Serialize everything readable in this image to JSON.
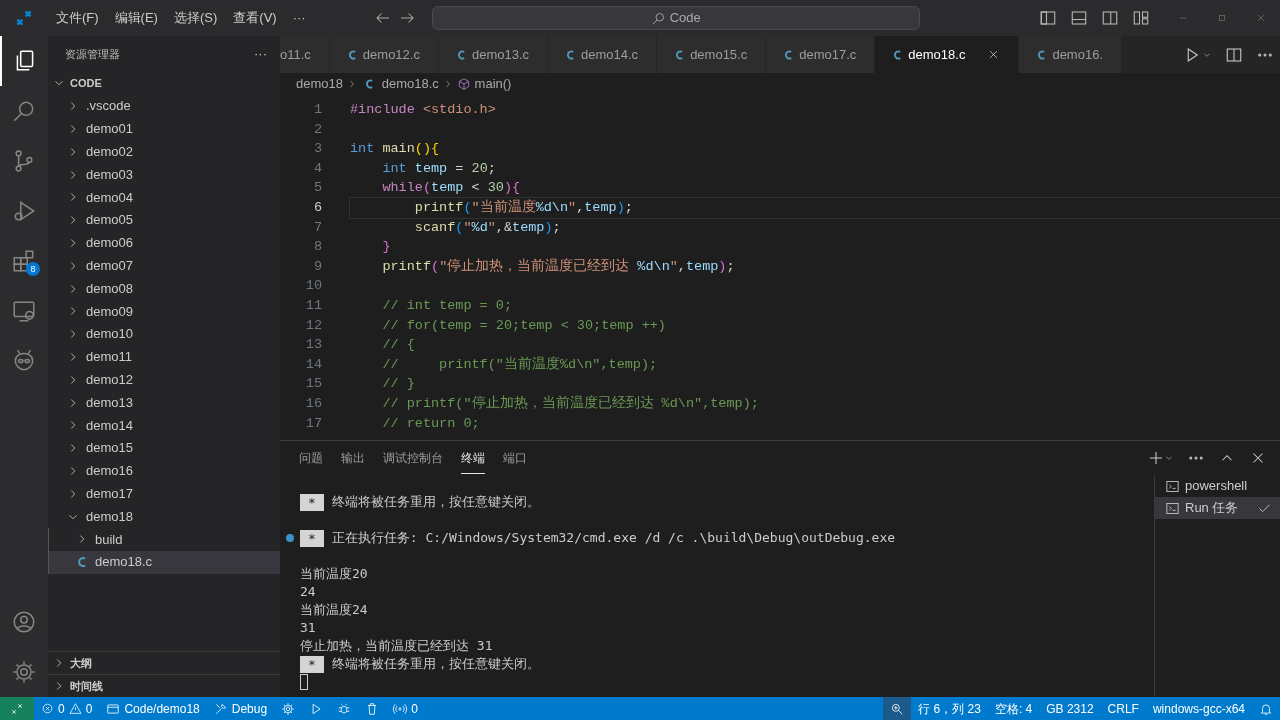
{
  "title_bar": {
    "menus": [
      "文件(F)",
      "编辑(E)",
      "选择(S)",
      "查看(V)",
      "···"
    ],
    "search": {
      "placeholder": "Code"
    }
  },
  "activity_bar": {
    "items": [
      {
        "kind": "files",
        "selected": true
      },
      {
        "kind": "search",
        "selected": false
      },
      {
        "kind": "source-control",
        "selected": false
      },
      {
        "kind": "run-debug",
        "selected": false
      },
      {
        "kind": "extensions",
        "selected": false,
        "badge": "8"
      },
      {
        "kind": "remote",
        "selected": false
      },
      {
        "kind": "alien",
        "selected": false
      }
    ],
    "bottom": [
      {
        "kind": "account"
      },
      {
        "kind": "settings"
      }
    ]
  },
  "sidebar": {
    "title": "资源管理器",
    "more": "···",
    "root": {
      "label": "CODE",
      "expanded": true
    },
    "items": [
      {
        "label": ".vscode",
        "kind": "folder",
        "expanded": false,
        "selected": false
      },
      {
        "label": "demo01",
        "kind": "folder",
        "expanded": false,
        "selected": false
      },
      {
        "label": "demo02",
        "kind": "folder",
        "expanded": false,
        "selected": false
      },
      {
        "label": "demo03",
        "kind": "folder",
        "expanded": false,
        "selected": false
      },
      {
        "label": "demo04",
        "kind": "folder",
        "expanded": false,
        "selected": false
      },
      {
        "label": "demo05",
        "kind": "folder",
        "expanded": false,
        "selected": false
      },
      {
        "label": "demo06",
        "kind": "folder",
        "expanded": false,
        "selected": false
      },
      {
        "label": "demo07",
        "kind": "folder",
        "expanded": false,
        "selected": false
      },
      {
        "label": "demo08",
        "kind": "folder",
        "expanded": false,
        "selected": false
      },
      {
        "label": "demo09",
        "kind": "folder",
        "expanded": false,
        "selected": false
      },
      {
        "label": "demo10",
        "kind": "folder",
        "expanded": false,
        "selected": false
      },
      {
        "label": "demo11",
        "kind": "folder",
        "expanded": false,
        "selected": false
      },
      {
        "label": "demo12",
        "kind": "folder",
        "expanded": false,
        "selected": false
      },
      {
        "label": "demo13",
        "kind": "folder",
        "expanded": false,
        "selected": false
      },
      {
        "label": "demo14",
        "kind": "folder",
        "expanded": false,
        "selected": false
      },
      {
        "label": "demo15",
        "kind": "folder",
        "expanded": false,
        "selected": false
      },
      {
        "label": "demo16",
        "kind": "folder",
        "expanded": false,
        "selected": false
      },
      {
        "label": "demo17",
        "kind": "folder",
        "expanded": false,
        "selected": false
      },
      {
        "label": "demo18",
        "kind": "folder",
        "expanded": true,
        "selected": false,
        "children": [
          {
            "label": "build",
            "kind": "folder",
            "expanded": false,
            "selected": false
          },
          {
            "label": "demo18.c",
            "kind": "c-file",
            "selected": true
          }
        ]
      }
    ],
    "sections": [
      {
        "label": "大纲",
        "expanded": false
      },
      {
        "label": "时间线",
        "expanded": false
      }
    ]
  },
  "tabs": [
    {
      "label": "o11.c",
      "icon": false,
      "selected": false
    },
    {
      "label": "demo12.c",
      "icon": true,
      "selected": false
    },
    {
      "label": "demo13.c",
      "icon": true,
      "selected": false
    },
    {
      "label": "demo14.c",
      "icon": true,
      "selected": false
    },
    {
      "label": "demo15.c",
      "icon": true,
      "selected": false
    },
    {
      "label": "demo17.c",
      "icon": true,
      "selected": false
    },
    {
      "label": "demo18.c",
      "icon": true,
      "selected": true
    },
    {
      "label": "demo16.",
      "icon": true,
      "selected": false
    }
  ],
  "breadcrumb": [
    "demo18",
    "demo18.c",
    "main()"
  ],
  "code": [
    {
      "n": "1",
      "selected": false,
      "tokens": [
        {
          "t": "#include",
          "kind": "pre"
        },
        {
          "t": " <stdio.h>",
          "kind": "str"
        }
      ]
    },
    {
      "n": "2",
      "selected": false
    },
    {
      "n": "3",
      "selected": false,
      "tokens": [
        {
          "t": "int",
          "kind": "kw"
        },
        {
          "t": " main",
          "kind": "fn"
        },
        {
          "t": "(){",
          "kind": "br1"
        }
      ]
    },
    {
      "n": "4",
      "selected": false,
      "tokens": [
        {
          "t": "    int",
          "kind": "kw"
        },
        {
          "t": " temp",
          "kind": "var"
        },
        {
          "t": " = ",
          "kind": "plain"
        },
        {
          "t": "20",
          "kind": "num"
        },
        {
          "t": ";",
          "kind": "plain"
        }
      ]
    },
    {
      "n": "5",
      "selected": false,
      "tokens": [
        {
          "t": "    while",
          "kind": "ctrl"
        },
        {
          "t": "(",
          "kind": "br2"
        },
        {
          "t": "temp",
          "kind": "var"
        },
        {
          "t": " < ",
          "kind": "plain"
        },
        {
          "t": "30",
          "kind": "num"
        },
        {
          "t": "){",
          "kind": "br2"
        }
      ]
    },
    {
      "n": "6",
      "selected": true,
      "tokens": [
        {
          "t": "        printf",
          "kind": "fn"
        },
        {
          "t": "(",
          "kind": "br3"
        },
        {
          "t": "\"当前温度",
          "kind": "str"
        },
        {
          "t": "%d\\n",
          "kind": "fmt"
        },
        {
          "t": "\"",
          "kind": "str"
        },
        {
          "t": ",",
          "kind": "plain"
        },
        {
          "t": "temp",
          "kind": "var"
        },
        {
          "t": ")",
          "kind": "br3"
        },
        {
          "t": ";",
          "kind": "plain"
        }
      ]
    },
    {
      "n": "7",
      "selected": false,
      "tokens": [
        {
          "t": "        scanf",
          "kind": "fn"
        },
        {
          "t": "(",
          "kind": "br3"
        },
        {
          "t": "\"",
          "kind": "str"
        },
        {
          "t": "%d",
          "kind": "fmt"
        },
        {
          "t": "\"",
          "kind": "str"
        },
        {
          "t": ",&",
          "kind": "plain"
        },
        {
          "t": "temp",
          "kind": "var"
        },
        {
          "t": ")",
          "kind": "br3"
        },
        {
          "t": ";",
          "kind": "plain"
        }
      ]
    },
    {
      "n": "8",
      "selected": false,
      "tokens": [
        {
          "t": "    }",
          "kind": "br2"
        }
      ]
    },
    {
      "n": "9",
      "selected": false,
      "tokens": [
        {
          "t": "    printf",
          "kind": "fn"
        },
        {
          "t": "(",
          "kind": "br2"
        },
        {
          "t": "\"停止加热，当前温度已经到达 ",
          "kind": "str"
        },
        {
          "t": "%d\\n",
          "kind": "fmt"
        },
        {
          "t": "\"",
          "kind": "str"
        },
        {
          "t": ",",
          "kind": "plain"
        },
        {
          "t": "temp",
          "kind": "var"
        },
        {
          "t": ")",
          "kind": "br2"
        },
        {
          "t": ";",
          "kind": "plain"
        }
      ]
    },
    {
      "n": "10",
      "selected": false
    },
    {
      "n": "11",
      "selected": false,
      "tokens": [
        {
          "t": "    // int temp = 0;",
          "kind": "cmt"
        }
      ]
    },
    {
      "n": "12",
      "selected": false,
      "tokens": [
        {
          "t": "    // for(temp = 20;temp < 30;temp ++)",
          "kind": "cmt"
        }
      ]
    },
    {
      "n": "13",
      "selected": false,
      "tokens": [
        {
          "t": "    // {",
          "kind": "cmt"
        }
      ]
    },
    {
      "n": "14",
      "selected": false,
      "tokens": [
        {
          "t": "    //     printf(\"当前温度%d\\n\",temp);",
          "kind": "cmt"
        }
      ]
    },
    {
      "n": "15",
      "selected": false,
      "tokens": [
        {
          "t": "    // }",
          "kind": "cmt"
        }
      ]
    },
    {
      "n": "16",
      "selected": false,
      "tokens": [
        {
          "t": "    // printf(\"停止加热，当前温度已经到达 %d\\n\",temp);",
          "kind": "cmt"
        }
      ]
    },
    {
      "n": "17",
      "selected": false,
      "tokens": [
        {
          "t": "    // return 0;",
          "kind": "cmt"
        }
      ]
    }
  ],
  "panel": {
    "tabs": [
      {
        "label": "问题",
        "selected": false
      },
      {
        "label": "输出",
        "selected": false
      },
      {
        "label": "调试控制台",
        "selected": false
      },
      {
        "label": "终端",
        "selected": true
      },
      {
        "label": "端口",
        "selected": false
      }
    ],
    "terminal": [
      {
        "kind": "blank"
      },
      {
        "kind": "task",
        "marker": "*",
        "text": "终端将被任务重用，按任意键关闭。"
      },
      {
        "kind": "blank"
      },
      {
        "kind": "running",
        "marker": "*",
        "text": "正在执行任务: C:/Windows/System32/cmd.exe /d /c .\\build\\Debug\\outDebug.exe"
      },
      {
        "kind": "blank"
      },
      {
        "kind": "output",
        "text": "当前温度20"
      },
      {
        "kind": "output",
        "text": "24"
      },
      {
        "kind": "output",
        "text": "当前温度24"
      },
      {
        "kind": "output",
        "text": "31"
      },
      {
        "kind": "output",
        "text": "停止加热，当前温度已经到达 31"
      },
      {
        "kind": "task",
        "marker": "*",
        "text": "终端将被任务重用，按任意键关闭。"
      },
      {
        "kind": "cursor"
      }
    ],
    "terminals": [
      {
        "label": "powershell",
        "selected": false,
        "done": false
      },
      {
        "label": "Run 任务",
        "selected": true,
        "done": true
      }
    ]
  },
  "status_bar": {
    "left": [
      {
        "kind": "remote"
      },
      {
        "kind": "problems",
        "errors": "0",
        "warnings": "0"
      },
      {
        "kind": "folder",
        "text": "Code/demo18"
      },
      {
        "kind": "tools",
        "text": "Debug"
      },
      {
        "kind": "gear"
      },
      {
        "kind": "run"
      },
      {
        "kind": "bug"
      },
      {
        "kind": "trash"
      },
      {
        "kind": "ports",
        "text": "0"
      }
    ],
    "right": [
      {
        "kind": "zoom"
      },
      {
        "kind": "text",
        "text": "行 6，列 23"
      },
      {
        "kind": "text",
        "text": "空格: 4"
      },
      {
        "kind": "text",
        "text": "GB 2312"
      },
      {
        "kind": "text",
        "text": "CRLF"
      },
      {
        "kind": "text",
        "text": "windows-gcc-x64"
      },
      {
        "kind": "bell"
      }
    ]
  }
}
